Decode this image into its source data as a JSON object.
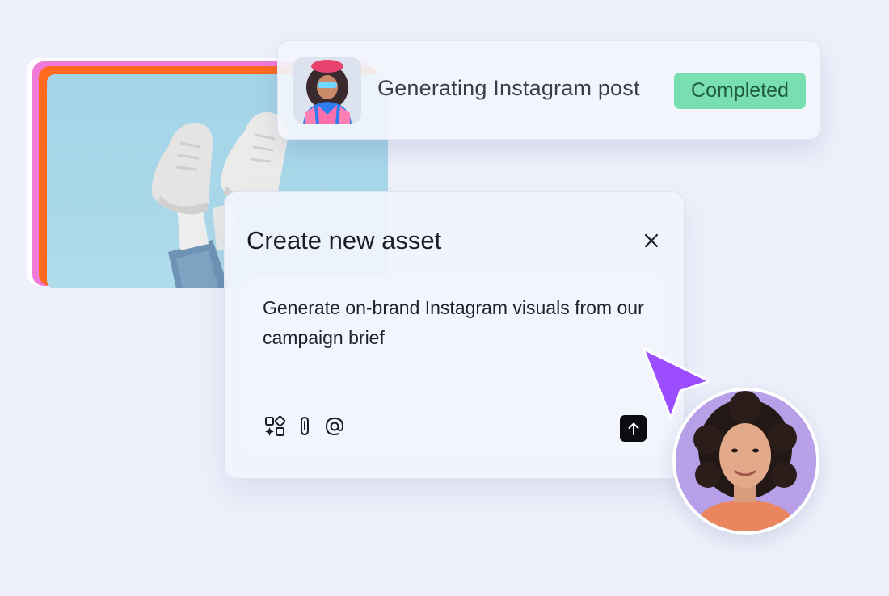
{
  "status": {
    "title": "Generating Instagram post",
    "badge": "Completed"
  },
  "dialog": {
    "title": "Create new asset",
    "prompt": "Generate on-brand Instagram visuals from our campaign brief",
    "tools": [
      "shapes-sparkle-icon",
      "paperclip-icon",
      "at-mention-icon"
    ],
    "send_icon": "arrow-up-icon",
    "close_icon": "close-icon"
  },
  "colors": {
    "badge_bg": "#79dfb0",
    "cursor": "#9b4dff",
    "avatar_bg": "#b7a0e8",
    "card_pink": "#f07ad8",
    "card_orange": "#ff6a1f"
  }
}
